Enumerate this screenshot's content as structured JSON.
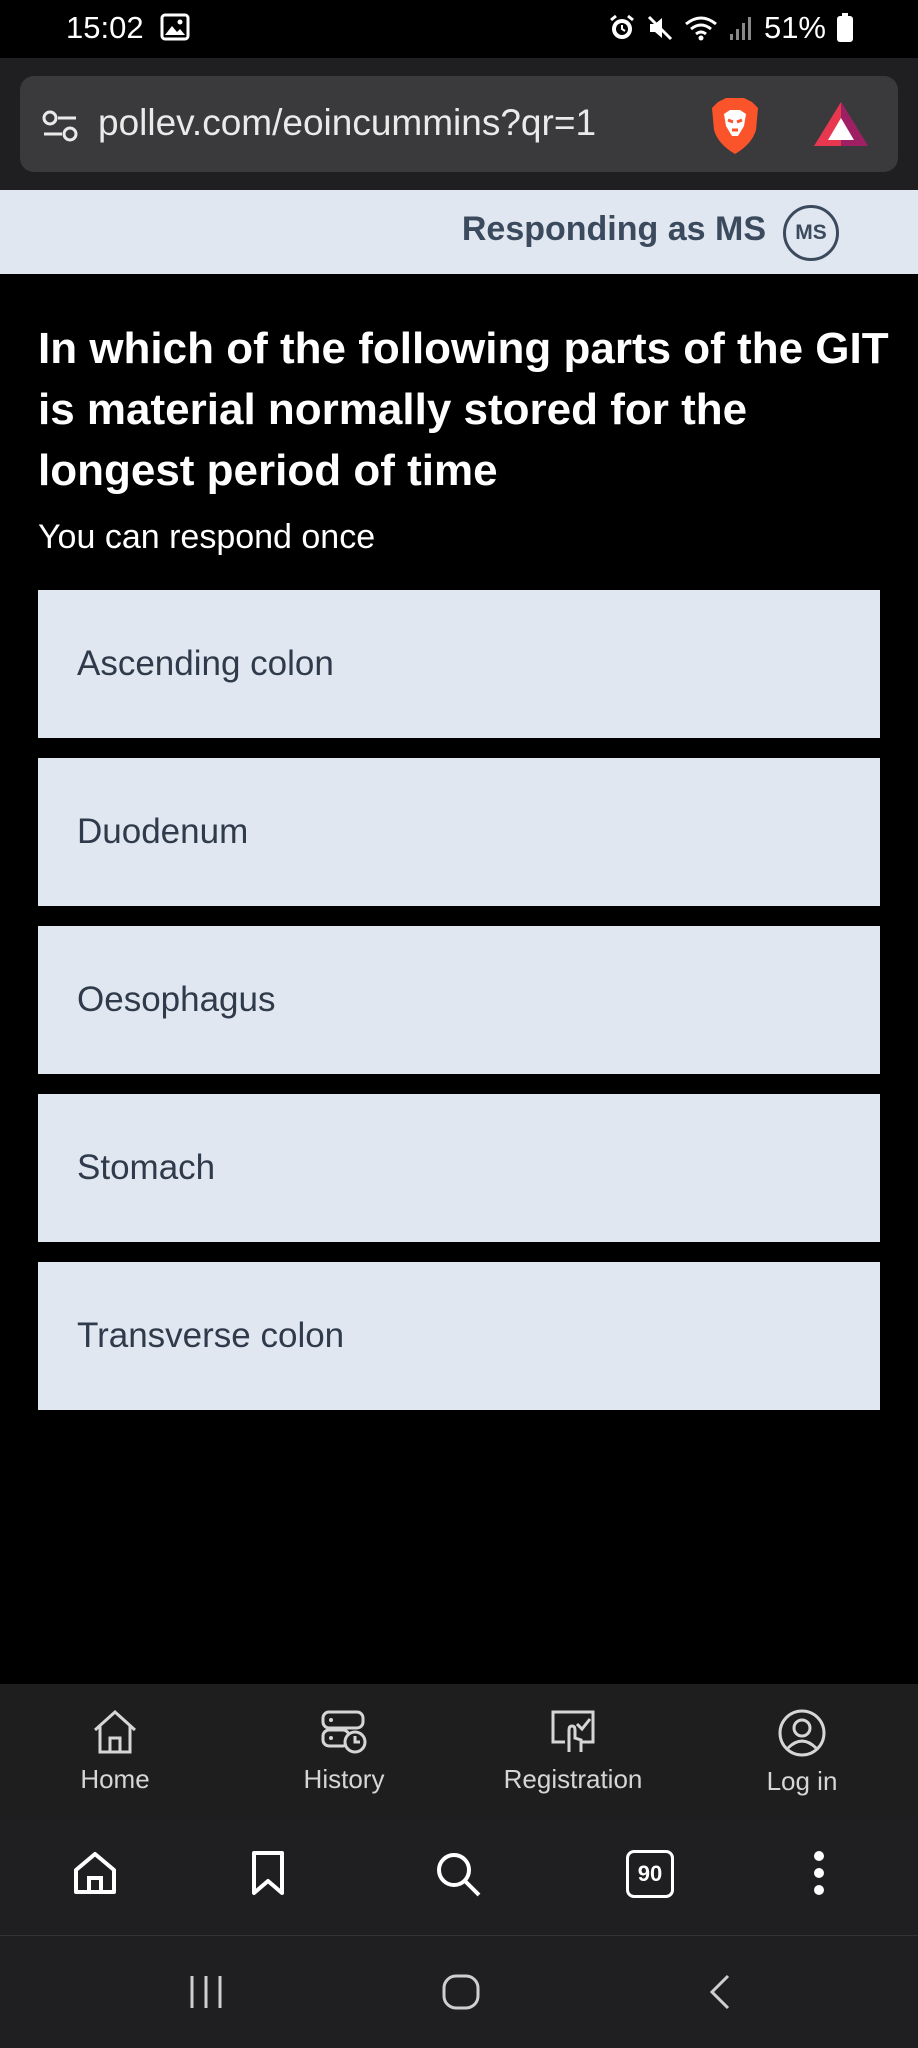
{
  "status_bar": {
    "time": "15:02",
    "battery": "51%",
    "icons": [
      "gallery-icon",
      "alarm-icon",
      "mute-icon",
      "wifi-icon",
      "signal-icon",
      "battery-icon"
    ]
  },
  "browser": {
    "url": "pollev.com/eoincummins?qr=1",
    "icons": [
      "site-settings-icon",
      "brave-shield-icon",
      "brave-rewards-icon"
    ]
  },
  "header": {
    "responding_as": "Responding as MS",
    "avatar_initials": "MS"
  },
  "poll": {
    "question": "In which of the following parts of the GIT is material normally stored for the longest period of time",
    "note": "You can respond once",
    "options": [
      {
        "label": "Ascending colon"
      },
      {
        "label": "Duodenum"
      },
      {
        "label": "Oesophagus"
      },
      {
        "label": "Stomach"
      },
      {
        "label": "Transverse colon"
      }
    ]
  },
  "poll_nav": {
    "items": [
      {
        "label": "Home",
        "icon": "home-icon"
      },
      {
        "label": "History",
        "icon": "history-icon"
      },
      {
        "label": "Registration",
        "icon": "registration-icon"
      },
      {
        "label": "Log in",
        "icon": "user-icon"
      }
    ]
  },
  "browser_bottom": {
    "tab_count": "90",
    "icons": [
      "home-icon",
      "bookmark-icon",
      "search-icon",
      "tabs-icon",
      "more-icon"
    ]
  },
  "android_nav": {
    "icons": [
      "recents-icon",
      "home-icon",
      "back-icon"
    ]
  },
  "colors": {
    "background": "#000000",
    "option_bg": "#e0e7f0",
    "text_dark": "#2f3a4a",
    "brave_orange": "#fb542b"
  }
}
